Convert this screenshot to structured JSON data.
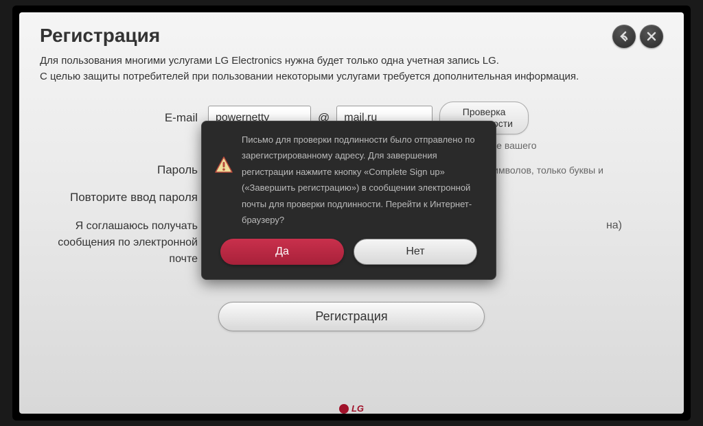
{
  "title": "Регистрация",
  "desc_line1": "Для пользования многими услугами LG Electronics нужна будет только одна учетная запись LG.",
  "desc_line2": "С целью защиты потребителей при пользовании некоторыми услугами требуется дополнительная информация.",
  "form": {
    "email_label": "E-mail",
    "email_local": "powernetty",
    "at": "@",
    "email_domain": "mail.ru",
    "verify_btn": "Проверка\nподлинности",
    "email_hint": "зования в качестве вашего",
    "password_label": "Пароль",
    "password_hint": "От 6 до 12 символов, только буквы и",
    "confirm_label": "Повторите ввод пароля"
  },
  "consent": {
    "label": "Я соглашаюсь получать сообщения по электронной почте",
    "trail": "на)"
  },
  "register_btn": "Регистрация",
  "modal": {
    "text": "Письмо для проверки подлинности было отправлено по зарегистрированному адресу. Для завершения регистрации нажмите кнопку «Complete Sign up» («Завершить регистрацию») в сообщении электронной почты для проверки подлинности. Перейти к Интернет-браузеру?",
    "yes": "Да",
    "no": "Нет"
  },
  "logo": "LG"
}
